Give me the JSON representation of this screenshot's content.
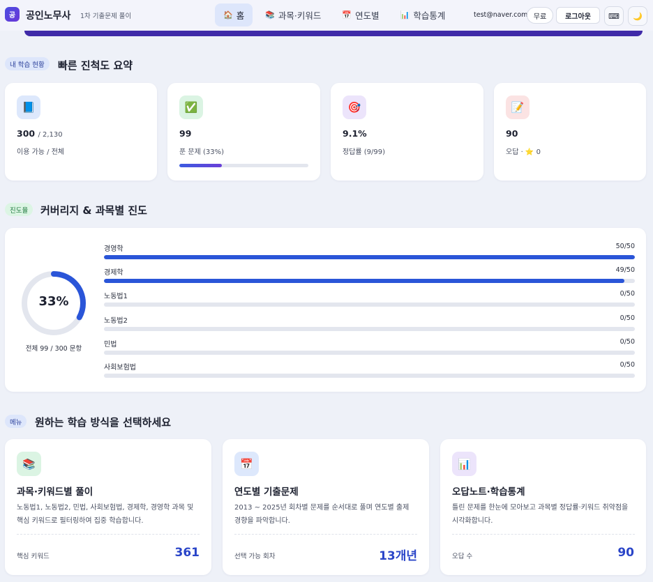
{
  "header": {
    "logo_text": "공",
    "title": "공인노무사",
    "subtitle": "1차 기출문제 풀이",
    "nav": [
      {
        "icon": "🏠",
        "label": "홈",
        "active": true
      },
      {
        "icon": "📚",
        "label": "과목·키워드",
        "active": false
      },
      {
        "icon": "📅",
        "label": "연도별",
        "active": false
      },
      {
        "icon": "📊",
        "label": "학습통계",
        "active": false
      }
    ],
    "email": "test@naver.com",
    "plan_badge": "무료",
    "logout_label": "로그아웃",
    "keyboard_icon": "⌨",
    "theme_icon": "🌙"
  },
  "summary": {
    "chip": "내 학습 현황",
    "title": "빠른 진척도 요약",
    "cards": [
      {
        "icon": "📘",
        "value": "300",
        "value_sub": "/ 2,130",
        "desc": "이용 가능 / 전체"
      },
      {
        "icon": "✅",
        "value": "99",
        "value_sub": "",
        "desc": "푼 문제 (33%)",
        "progress": 0.33
      },
      {
        "icon": "🎯",
        "value": "9.1%",
        "value_sub": "",
        "desc": "정답률 (9/99)"
      },
      {
        "icon": "📝",
        "value": "90",
        "value_sub": "",
        "desc": "오답 · ⭐ 0"
      }
    ]
  },
  "coverage": {
    "chip": "진도율",
    "title": "커버리지 & 과목별 진도",
    "percent_label": "33%",
    "percent": 0.33,
    "caption": "전체 99 / 300 문항",
    "subjects": [
      {
        "name": "경영학",
        "count": "50/50",
        "done": 50,
        "total": 50
      },
      {
        "name": "경제학",
        "count": "49/50",
        "done": 49,
        "total": 50
      },
      {
        "name": "노동법1",
        "count": "0/50",
        "done": 0,
        "total": 50
      },
      {
        "name": "노동법2",
        "count": "0/50",
        "done": 0,
        "total": 50
      },
      {
        "name": "민법",
        "count": "0/50",
        "done": 0,
        "total": 50
      },
      {
        "name": "사회보험법",
        "count": "0/50",
        "done": 0,
        "total": 50
      }
    ]
  },
  "menu": {
    "chip": "메뉴",
    "title": "원하는 학습 방식을 선택하세요",
    "cards": [
      {
        "icon": "📚",
        "title": "과목·키워드별 풀이",
        "desc": "노동법1, 노동법2, 민법, 사회보험법, 경제학, 경영학 과목 및 핵심 키워드로 필터링하여 집중 학습합니다.",
        "label": "핵심 키워드",
        "value": "361"
      },
      {
        "icon": "📅",
        "title": "연도별 기출문제",
        "desc": "2013 ~ 2025년 회차별 문제를 순서대로 풀며 연도별 출제 경향을 파악합니다.",
        "label": "선택 가능 회차",
        "value": "13개년"
      },
      {
        "icon": "📊",
        "title": "오답노트·학습통계",
        "desc": "틀린 문제를 한눈에 모아보고 과목별 정답률·키워드 취약점을 시각화합니다.",
        "label": "오답 수",
        "value": "90"
      }
    ]
  },
  "colors": {
    "accent": "#2a55d8",
    "brand": "#4b4ee0",
    "background": "#eef1f8"
  }
}
